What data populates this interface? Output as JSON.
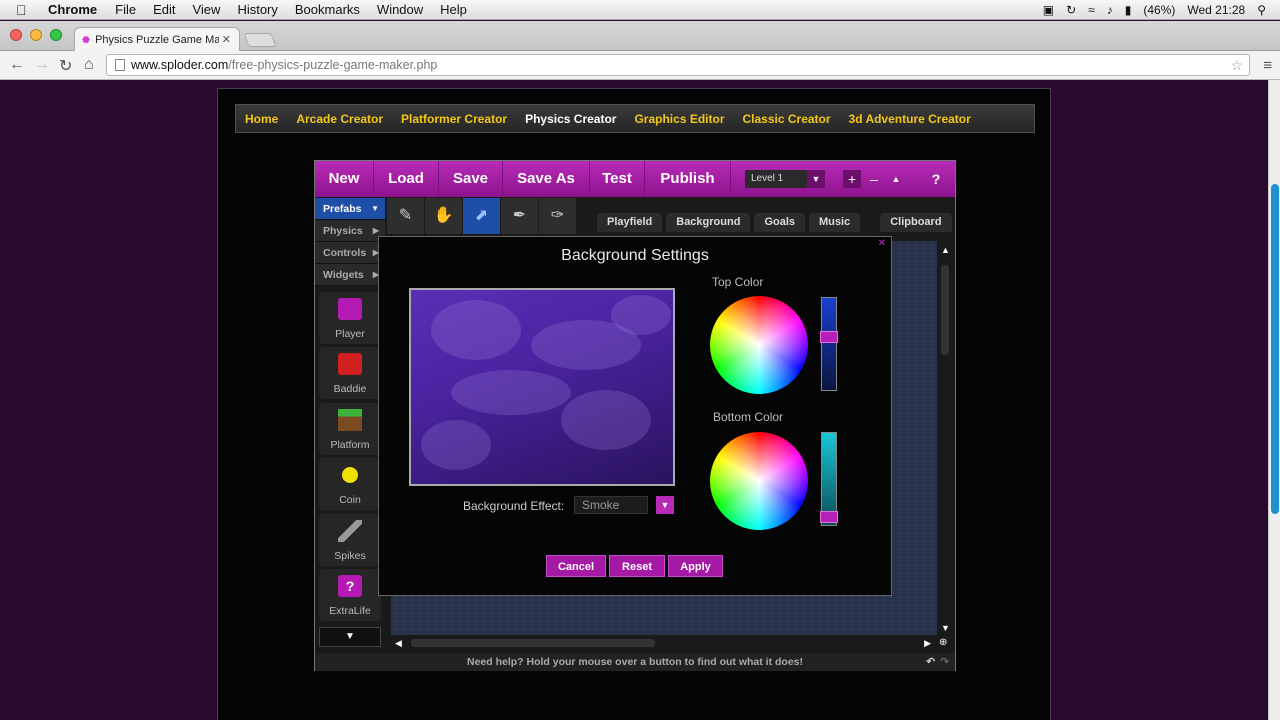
{
  "menubar": {
    "app": "Chrome",
    "items": [
      "File",
      "Edit",
      "View",
      "History",
      "Bookmarks",
      "Window",
      "Help"
    ],
    "battery": "(46%)",
    "clock": "Wed 21:28"
  },
  "browser": {
    "tab_title": "Physics Puzzle Game Mak",
    "url_host": "www.sploder.com",
    "url_path": "/free-physics-puzzle-game-maker.php"
  },
  "site_nav": {
    "items": [
      "Home",
      "Arcade Creator",
      "Platformer Creator",
      "Physics Creator",
      "Graphics Editor",
      "Classic Creator",
      "3d Adventure Creator"
    ],
    "active": "Physics Creator"
  },
  "app": {
    "top_buttons": [
      "New",
      "Load",
      "Save",
      "Save As",
      "Test",
      "Publish"
    ],
    "level": "Level 1",
    "help": "?",
    "left_tabs": [
      "Prefabs",
      "Physics",
      "Controls",
      "Widgets"
    ],
    "view_tabs": [
      "Playfield",
      "Background",
      "Goals",
      "Music"
    ],
    "clipboard": "Clipboard",
    "palette": [
      "Player",
      "Baddie",
      "Platform",
      "Coin",
      "Spikes",
      "ExtraLife"
    ],
    "status": "Need help? Hold your mouse over a button to find out what it does!"
  },
  "dialog": {
    "title": "Background Settings",
    "effect_label": "Background Effect:",
    "effect_value": "Smoke",
    "top_color_label": "Top Color",
    "bottom_color_label": "Bottom Color",
    "top_color_level": 0.4,
    "bottom_color_level": 0.95,
    "buttons": {
      "cancel": "Cancel",
      "reset": "Reset",
      "apply": "Apply"
    }
  },
  "colors": {
    "app_magenta": "#a51aa5",
    "site_nav_link": "#f3c71a",
    "top_color": "#1a3fd0",
    "bottom_color": "#11a6b8"
  }
}
